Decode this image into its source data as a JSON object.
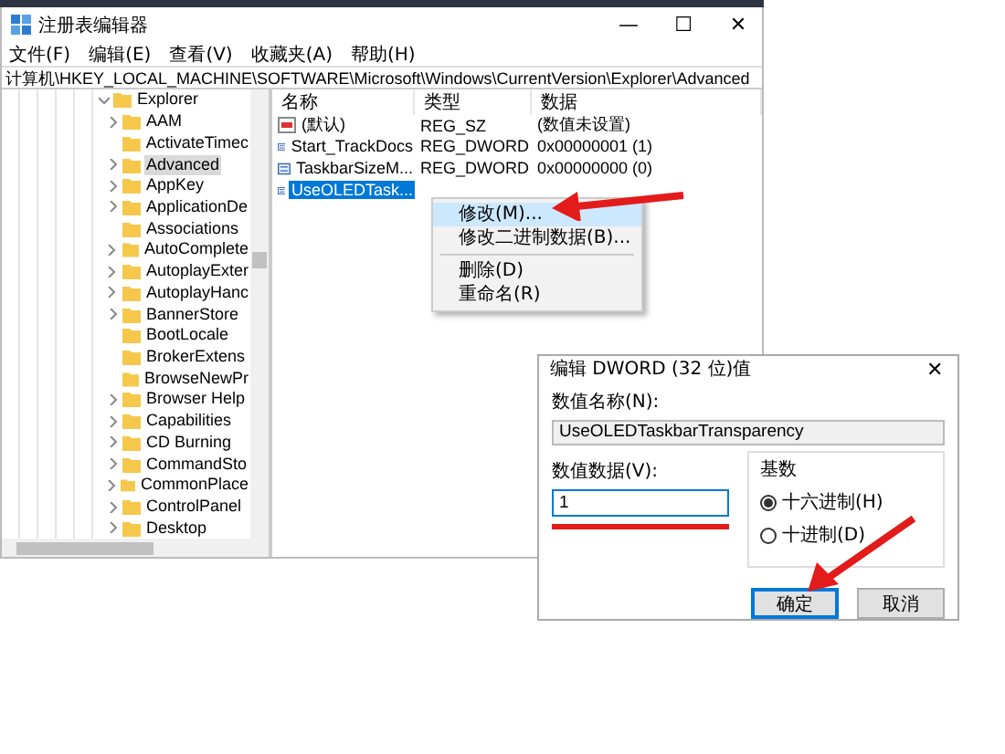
{
  "window": {
    "title": "注册表编辑器",
    "controls": [
      "—",
      "☐",
      "✕"
    ]
  },
  "menu": [
    "文件(F)",
    "编辑(E)",
    "查看(V)",
    "收藏夹(A)",
    "帮助(H)"
  ],
  "address": "计算机\\HKEY_LOCAL_MACHINE\\SOFTWARE\\Microsoft\\Windows\\CurrentVersion\\Explorer\\Advanced",
  "tree": {
    "label": "Explorer",
    "expanded": true,
    "children": [
      {
        "label": "AAM",
        "has_children": true,
        "selected": false
      },
      {
        "label": "ActivateTimec",
        "has_children": false,
        "selected": false
      },
      {
        "label": "Advanced",
        "has_children": true,
        "selected": true
      },
      {
        "label": "AppKey",
        "has_children": true,
        "selected": false
      },
      {
        "label": "ApplicationDe",
        "has_children": true,
        "selected": false
      },
      {
        "label": "Associations",
        "has_children": false,
        "selected": false
      },
      {
        "label": "AutoComplete",
        "has_children": true,
        "selected": false
      },
      {
        "label": "AutoplayExter",
        "has_children": true,
        "selected": false
      },
      {
        "label": "AutoplayHanc",
        "has_children": true,
        "selected": false
      },
      {
        "label": "BannerStore",
        "has_children": true,
        "selected": false
      },
      {
        "label": "BootLocale",
        "has_children": false,
        "selected": false
      },
      {
        "label": "BrokerExtens",
        "has_children": false,
        "selected": false
      },
      {
        "label": "BrowseNewPr",
        "has_children": false,
        "selected": false
      },
      {
        "label": "Browser Help",
        "has_children": true,
        "selected": false
      },
      {
        "label": "Capabilities",
        "has_children": true,
        "selected": false
      },
      {
        "label": "CD Burning",
        "has_children": true,
        "selected": false
      },
      {
        "label": "CommandSto",
        "has_children": true,
        "selected": false
      },
      {
        "label": "CommonPlace",
        "has_children": true,
        "selected": false
      },
      {
        "label": "ControlPanel",
        "has_children": true,
        "selected": false
      },
      {
        "label": "Desktop",
        "has_children": true,
        "selected": false
      }
    ]
  },
  "columns": [
    "名称",
    "类型",
    "数据"
  ],
  "values": [
    {
      "kind": "string",
      "name": "(默认)",
      "type": "REG_SZ",
      "data": "(数值未设置)",
      "selected": false
    },
    {
      "kind": "dword",
      "name": "Start_TrackDocs",
      "type": "REG_DWORD",
      "data": "0x00000001 (1)",
      "selected": false
    },
    {
      "kind": "dword",
      "name": "TaskbarSizeM...",
      "type": "REG_DWORD",
      "data": "0x00000000 (0)",
      "selected": false
    },
    {
      "kind": "dword",
      "name": "UseOLEDTask...",
      "selected": true
    }
  ],
  "context_menu": [
    {
      "kind": "item",
      "label": "修改(M)...",
      "selected": true
    },
    {
      "kind": "item",
      "label": "修改二进制数据(B)...",
      "selected": false
    },
    {
      "kind": "separator"
    },
    {
      "kind": "item",
      "label": "删除(D)",
      "selected": false
    },
    {
      "kind": "item",
      "label": "重命名(R)",
      "selected": false
    }
  ],
  "dialog": {
    "title": "编辑 DWORD (32 位)值",
    "close": "✕",
    "name_label": "数值名称(N):",
    "name_value": "UseOLEDTaskbarTransparency",
    "data_label": "数值数据(V):",
    "data_value": "1",
    "base_label": "基数",
    "bases": [
      {
        "label": "十六进制(H)",
        "selected": true
      },
      {
        "label": "十进制(D)",
        "selected": false
      }
    ],
    "buttons": [
      {
        "label": "确定",
        "focused": true
      },
      {
        "label": "取消",
        "focused": false
      }
    ]
  }
}
